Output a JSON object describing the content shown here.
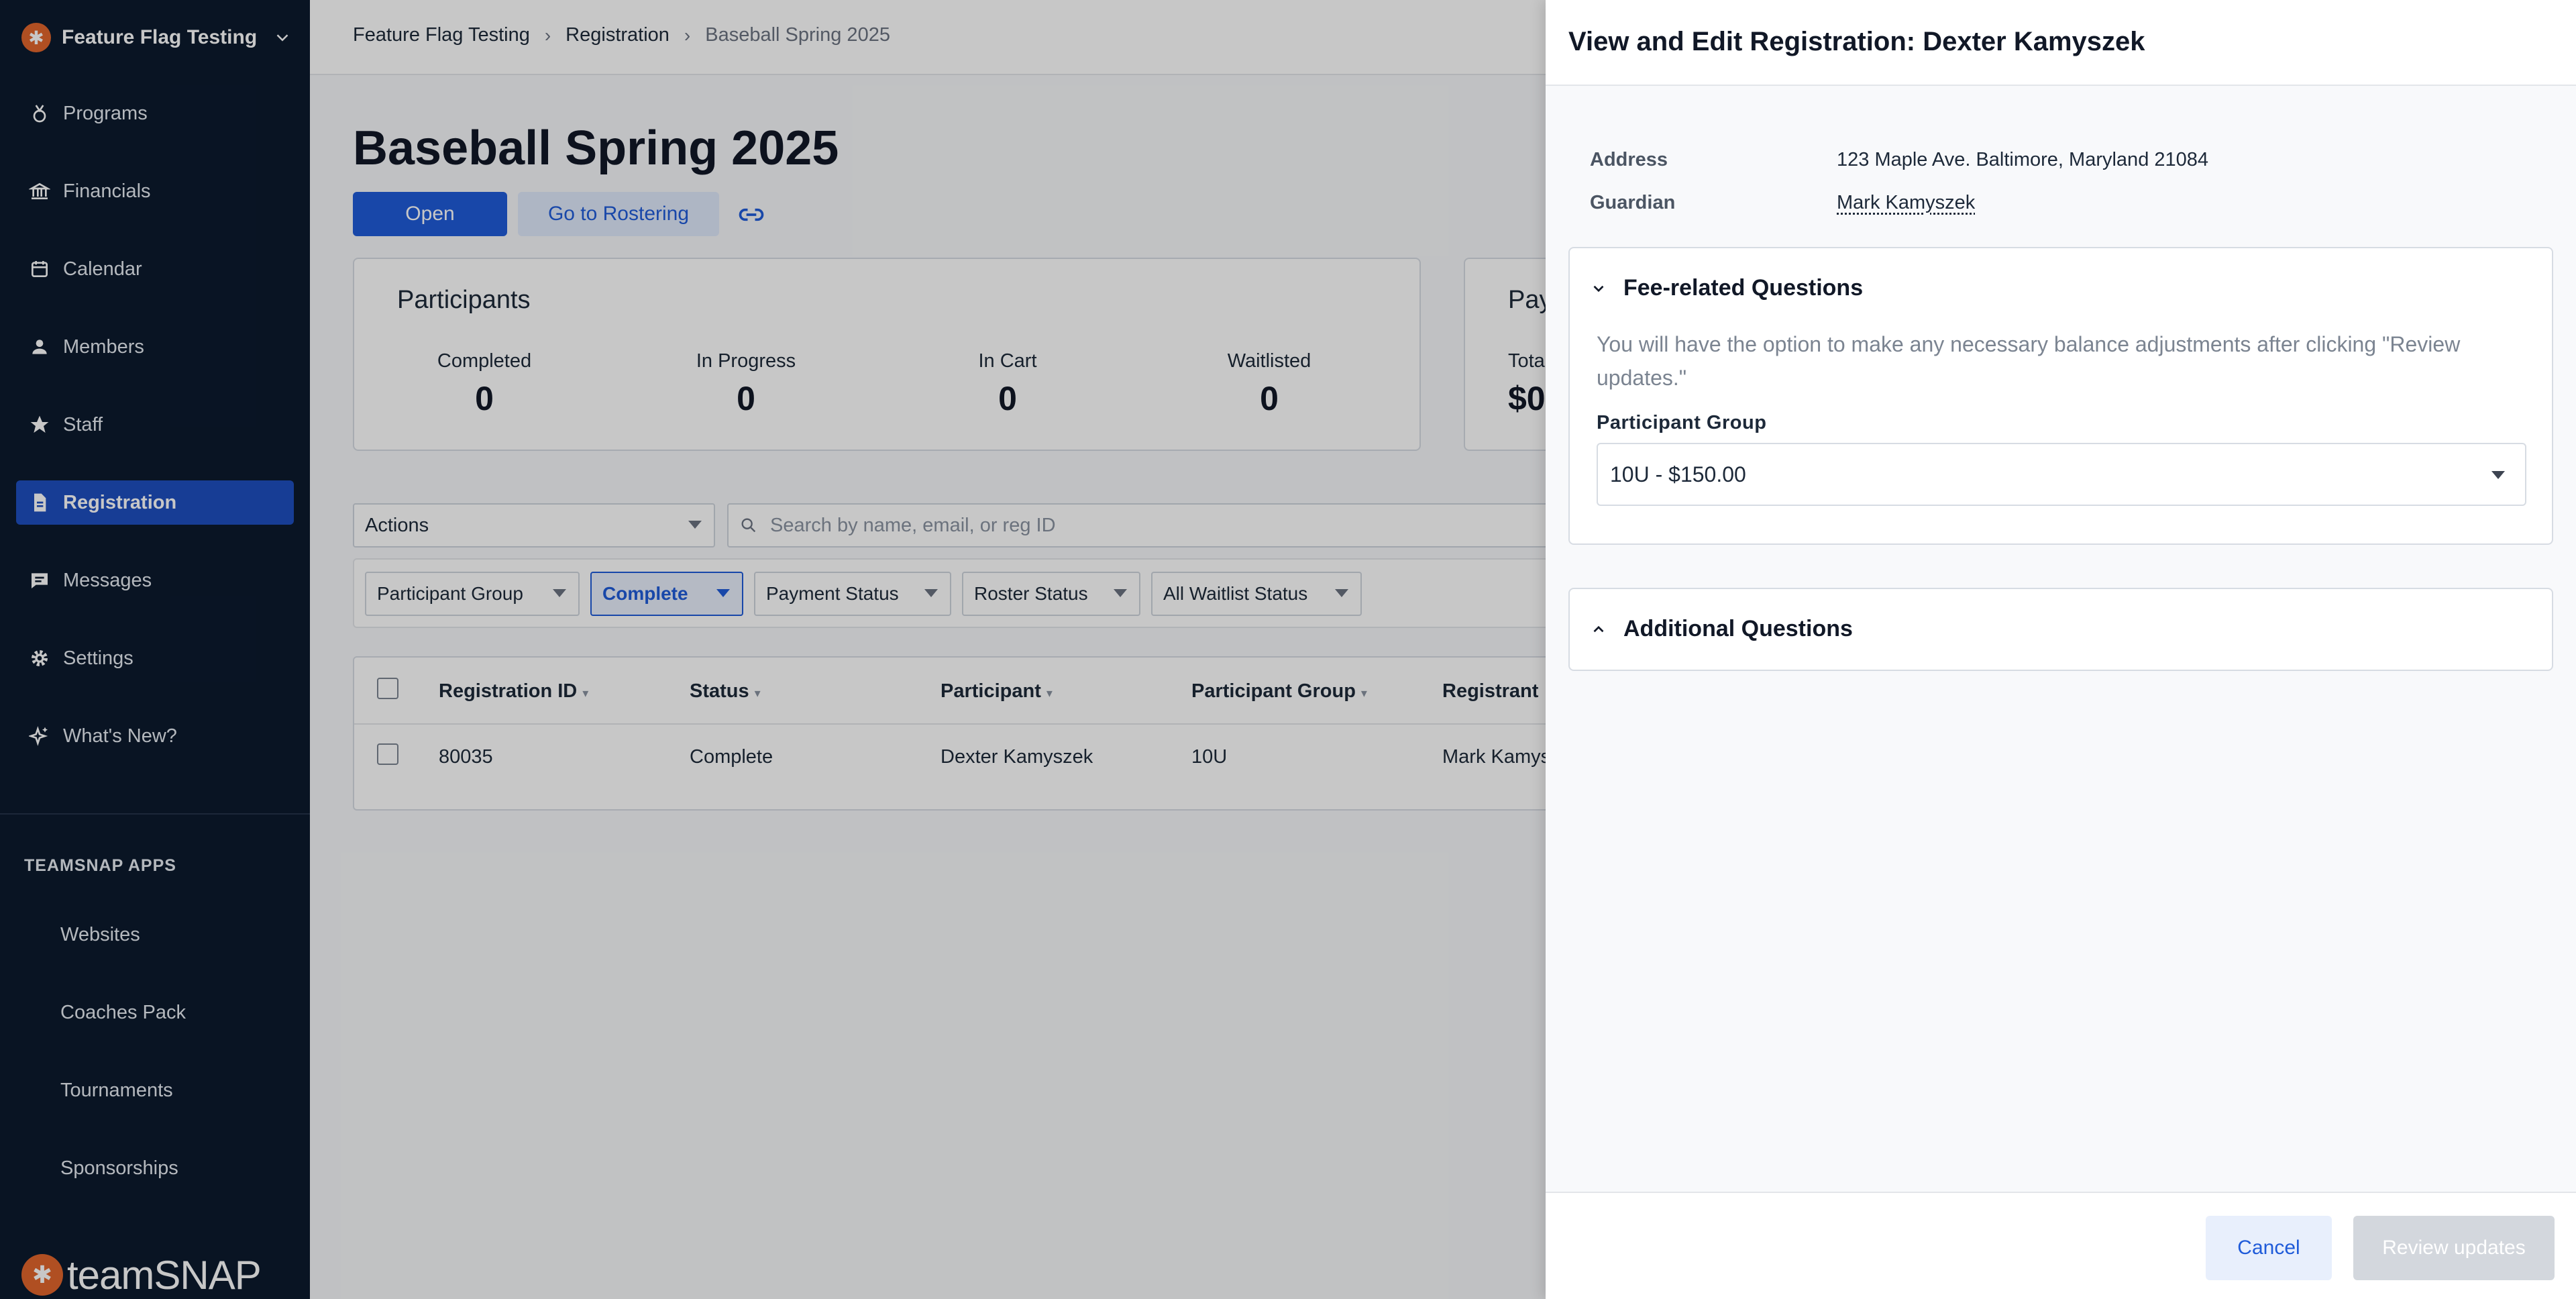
{
  "sidebar": {
    "org_name": "Feature Flag Testing",
    "items": [
      {
        "label": "Programs",
        "icon": "trophy-icon"
      },
      {
        "label": "Financials",
        "icon": "bank-icon"
      },
      {
        "label": "Calendar",
        "icon": "calendar-icon"
      },
      {
        "label": "Members",
        "icon": "person-icon"
      },
      {
        "label": "Staff",
        "icon": "star-icon"
      },
      {
        "label": "Registration",
        "icon": "document-icon",
        "active": true
      },
      {
        "label": "Messages",
        "icon": "message-icon"
      },
      {
        "label": "Settings",
        "icon": "gear-icon"
      },
      {
        "label": "What's New?",
        "icon": "sparkle-icon"
      }
    ],
    "apps_heading": "TEAMSNAP APPS",
    "apps": [
      "Websites",
      "Coaches Pack",
      "Tournaments",
      "Sponsorships"
    ],
    "brand": "teamSNAP"
  },
  "breadcrumb": [
    "Feature Flag Testing",
    "Registration",
    "Baseball Spring 2025"
  ],
  "page": {
    "title": "Baseball Spring 2025",
    "open_label": "Open",
    "rostering_label": "Go to Rostering"
  },
  "participants": {
    "title": "Participants",
    "stats": [
      {
        "label": "Completed",
        "value": "0"
      },
      {
        "label": "In Progress",
        "value": "0"
      },
      {
        "label": "In Cart",
        "value": "0"
      },
      {
        "label": "Waitlisted",
        "value": "0"
      }
    ]
  },
  "payments": {
    "title": "Pay",
    "total_label": "Tota",
    "total_value": "$0"
  },
  "toolbar": {
    "actions_label": "Actions",
    "search_placeholder": "Search by name, email, or reg ID"
  },
  "filters": [
    {
      "label": "Participant Group",
      "active": false
    },
    {
      "label": "Complete",
      "active": true
    },
    {
      "label": "Payment Status",
      "active": false
    },
    {
      "label": "Roster Status",
      "active": false
    },
    {
      "label": "All Waitlist Status",
      "active": false
    }
  ],
  "table": {
    "columns": [
      "Registration ID",
      "Status",
      "Participant",
      "Participant Group",
      "Registrant"
    ],
    "rows": [
      [
        "80035",
        "Complete",
        "Dexter Kamyszek",
        "10U",
        "Mark Kamys"
      ]
    ]
  },
  "drawer": {
    "title": "View and Edit Registration: Dexter Kamyszek",
    "address_label": "Address",
    "address_value": "123 Maple Ave. Baltimore, Maryland 21084",
    "guardian_label": "Guardian",
    "guardian_value": "Mark Kamyszek",
    "fee_section": {
      "title": "Fee-related Questions",
      "hint": "You will have the option to make any necessary balance adjustments after clicking \"Review updates.\"",
      "field_label": "Participant Group",
      "field_value": "10U - $150.00"
    },
    "additional_section": {
      "title": "Additional Questions"
    },
    "cancel_label": "Cancel",
    "review_label": "Review updates"
  },
  "colors": {
    "sidebar_bg": "#0c1a2e",
    "accent": "#1f5bd9",
    "brand_orange": "#e2662c"
  }
}
